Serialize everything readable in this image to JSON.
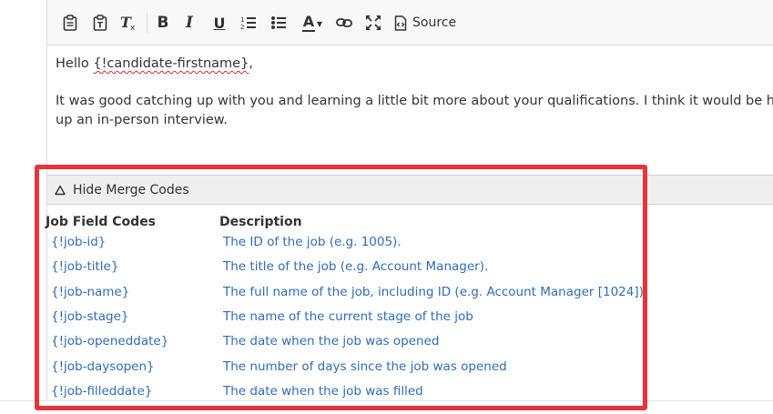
{
  "toolbar": {
    "source_label": "Source",
    "icons": [
      "paste-icon",
      "paste-text-icon",
      "remove-format-icon",
      "bold-icon",
      "italic-icon",
      "underline-icon",
      "numbered-list-icon",
      "bulleted-list-icon",
      "text-color-icon",
      "link-icon",
      "maximize-icon",
      "source-icon"
    ],
    "bold_glyph": "B",
    "italic_glyph": "I",
    "underline_glyph": "U",
    "text_color_glyph": "A"
  },
  "editor": {
    "greeting_prefix": "Hello ",
    "merge_token": "{!candidate-firstname}",
    "greeting_suffix": ",",
    "body_line1": "It was good catching up with you and learning a little bit more about your qualifications. I think it would be helpful",
    "body_line2": "up an in-person interview."
  },
  "merge_codes": {
    "toggle_label": "Hide Merge Codes",
    "columns": {
      "code": "Job Field Codes",
      "description": "Description"
    },
    "rows": [
      {
        "code": "{!job-id}",
        "description": "The ID of the job (e.g. 1005)."
      },
      {
        "code": "{!job-title}",
        "description": "The title of the job (e.g. Account Manager)."
      },
      {
        "code": "{!job-name}",
        "description": "The full name of the job, including ID (e.g. Account Manager [1024])"
      },
      {
        "code": "{!job-stage}",
        "description": "The name of the current stage of the job"
      },
      {
        "code": "{!job-openeddate}",
        "description": "The date when the job was opened"
      },
      {
        "code": "{!job-daysopen}",
        "description": "The number of days since the job was opened"
      },
      {
        "code": "{!job-filleddate}",
        "description": "The date when the job was filled"
      }
    ]
  },
  "colors": {
    "link": "#2f6db5",
    "highlight": "#e8333b",
    "toolbar_bg": "#f8f8f8"
  }
}
